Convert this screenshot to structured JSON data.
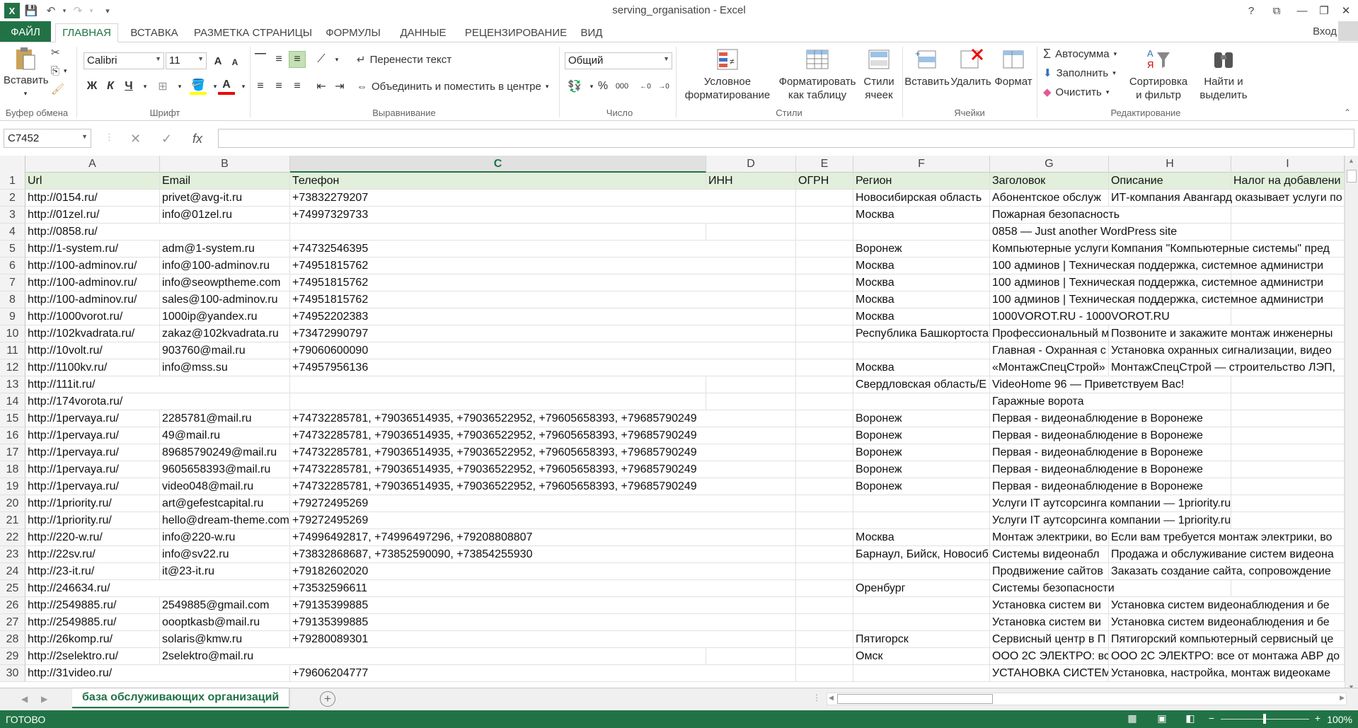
{
  "window": {
    "title": "serving_organisation - Excel",
    "signin": "Вход",
    "help": "?",
    "restore_ribbon": "⧉",
    "minimize": "—",
    "maximize": "❐",
    "close": "✕"
  },
  "tabs": [
    "ФАЙЛ",
    "ГЛАВНАЯ",
    "ВСТАВКА",
    "РАЗМЕТКА СТРАНИЦЫ",
    "ФОРМУЛЫ",
    "ДАННЫЕ",
    "РЕЦЕНЗИРОВАНИЕ",
    "ВИД"
  ],
  "ribbon": {
    "clipboard": {
      "label": "Буфер обмена",
      "paste": "Вставить"
    },
    "font": {
      "label": "Шрифт",
      "name": "Calibri",
      "size": "11",
      "bold": "Ж",
      "italic": "К",
      "underline": "Ч",
      "grow": "A",
      "shrink": "A"
    },
    "alignment": {
      "label": "Выравнивание",
      "wrap": "Перенести текст",
      "merge": "Объединить и поместить в центре"
    },
    "number": {
      "label": "Число",
      "format": "Общий",
      "percent": "%",
      "thousands": "000"
    },
    "styles": {
      "label": "Стили",
      "cond_line1": "Условное",
      "cond_line2": "форматирование",
      "table_line1": "Форматировать",
      "table_line2": "как таблицу",
      "cell_line1": "Стили",
      "cell_line2": "ячеек"
    },
    "cells": {
      "label": "Ячейки",
      "insert": "Вставить",
      "delete": "Удалить",
      "format": "Формат"
    },
    "editing": {
      "label": "Редактирование",
      "autosum": "Автосумма",
      "fill": "Заполнить",
      "clear": "Очистить",
      "sort_line1": "Сортировка",
      "sort_line2": "и фильтр",
      "find_line1": "Найти и",
      "find_line2": "выделить"
    }
  },
  "formula_bar": {
    "name_box": "C7452",
    "fx": "fx",
    "value": ""
  },
  "columns": [
    "A",
    "B",
    "C",
    "D",
    "E",
    "F",
    "G",
    "H",
    "I"
  ],
  "selected_column": "C",
  "rows": [
    {
      "n": "1",
      "c": [
        "Url",
        "Email",
        "Телефон",
        "ИНН",
        "ОГРН",
        "Регион",
        "Заголовок",
        "Описание",
        "Налог на добавлени"
      ]
    },
    {
      "n": "2",
      "c": [
        "http://0154.ru/",
        "privet@avg-it.ru",
        "+73832279207",
        "",
        "",
        "Новосибирская область",
        "Абонентское обслуж",
        "ИТ-компания Авангард оказывает услуги по",
        ""
      ]
    },
    {
      "n": "3",
      "c": [
        "http://01zel.ru/",
        "info@01zel.ru",
        "+74997329733",
        "",
        "",
        "Москва",
        "Пожарная безопасность",
        "",
        ""
      ]
    },
    {
      "n": "4",
      "c": [
        "http://0858.ru/",
        "",
        "",
        "",
        "",
        "",
        "0858 — Just another WordPress site",
        "",
        ""
      ]
    },
    {
      "n": "5",
      "c": [
        "http://1-system.ru/",
        "adm@1-system.ru",
        "+74732546395",
        "",
        "",
        "Воронеж",
        "Компьютерные услуги",
        "Компания \"Компьютерные системы\" пред",
        ""
      ]
    },
    {
      "n": "6",
      "c": [
        "http://100-adminov.ru/",
        "info@100-adminov.ru",
        "+74951815762",
        "",
        "",
        "Москва",
        "100 админов | Техническая поддержка, системное администри",
        "",
        ""
      ]
    },
    {
      "n": "7",
      "c": [
        "http://100-adminov.ru/",
        "info@seowptheme.com",
        "+74951815762",
        "",
        "",
        "Москва",
        "100 админов | Техническая поддержка, системное администри",
        "",
        ""
      ]
    },
    {
      "n": "8",
      "c": [
        "http://100-adminov.ru/",
        "sales@100-adminov.ru",
        "+74951815762",
        "",
        "",
        "Москва",
        "100 админов | Техническая поддержка, системное администри",
        "",
        ""
      ]
    },
    {
      "n": "9",
      "c": [
        "http://1000vorot.ru/",
        "1000ip@yandex.ru",
        "+74952202383",
        "",
        "",
        "Москва",
        "1000VOROT.RU - 1000VOROT.RU",
        "",
        ""
      ]
    },
    {
      "n": "10",
      "c": [
        "http://102kvadrata.ru/",
        "zakaz@102kvadrata.ru",
        "+73472990797",
        "",
        "",
        "Республика Башкортостан",
        "Профессиональный м",
        "Позвоните и закажите монтаж инженерны",
        ""
      ]
    },
    {
      "n": "11",
      "c": [
        "http://10volt.ru/",
        "903760@mail.ru",
        "+79060600090",
        "",
        "",
        "",
        "Главная - Охранная с",
        "Установка охранных сигнализации, видео",
        ""
      ]
    },
    {
      "n": "12",
      "c": [
        "http://1100kv.ru/",
        "info@mss.su",
        "+74957956136",
        "",
        "",
        "Москва",
        "«МонтажСпецСтрой»",
        "МонтажСпецСтрой — строительство ЛЭП,",
        ""
      ]
    },
    {
      "n": "13",
      "c": [
        "http://111it.ru/",
        "",
        "",
        "",
        "",
        "Свердловская область/Е",
        "VideoHome 96 — Приветствуем Вас!",
        "",
        ""
      ]
    },
    {
      "n": "14",
      "c": [
        "http://174vorota.ru/",
        "",
        "",
        "",
        "",
        "",
        "Гаражные ворота",
        "",
        ""
      ]
    },
    {
      "n": "15",
      "c": [
        "http://1pervaya.ru/",
        "2285781@mail.ru",
        "+74732285781, +79036514935, +79036522952, +79605658393, +79685790249",
        "",
        "",
        "Воронеж",
        "Первая - видеонаблюдение в Воронеже",
        "",
        ""
      ]
    },
    {
      "n": "16",
      "c": [
        "http://1pervaya.ru/",
        "49@mail.ru",
        "+74732285781, +79036514935, +79036522952, +79605658393, +79685790249",
        "",
        "",
        "Воронеж",
        "Первая - видеонаблюдение в Воронеже",
        "",
        ""
      ]
    },
    {
      "n": "17",
      "c": [
        "http://1pervaya.ru/",
        "89685790249@mail.ru",
        "+74732285781, +79036514935, +79036522952, +79605658393, +79685790249",
        "",
        "",
        "Воронеж",
        "Первая - видеонаблюдение в Воронеже",
        "",
        ""
      ]
    },
    {
      "n": "18",
      "c": [
        "http://1pervaya.ru/",
        "9605658393@mail.ru",
        "+74732285781, +79036514935, +79036522952, +79605658393, +79685790249",
        "",
        "",
        "Воронеж",
        "Первая - видеонаблюдение в Воронеже",
        "",
        ""
      ]
    },
    {
      "n": "19",
      "c": [
        "http://1pervaya.ru/",
        "video048@mail.ru",
        "+74732285781, +79036514935, +79036522952, +79605658393, +79685790249",
        "",
        "",
        "Воронеж",
        "Первая - видеонаблюдение в Воронеже",
        "",
        ""
      ]
    },
    {
      "n": "20",
      "c": [
        "http://1priority.ru/",
        "art@gefestcapital.ru",
        "+79272495269",
        "",
        "",
        "",
        "Услуги IT аутсорсинга компании — 1priority.ru",
        "",
        ""
      ]
    },
    {
      "n": "21",
      "c": [
        "http://1priority.ru/",
        "hello@dream-theme.com",
        "+79272495269",
        "",
        "",
        "",
        "Услуги IT аутсорсинга компании — 1priority.ru",
        "",
        ""
      ]
    },
    {
      "n": "22",
      "c": [
        "http://220-w.ru/",
        "info@220-w.ru",
        "+74996492817, +74996497296, +79208808807",
        "",
        "",
        "Москва",
        "Монтаж электрики, во",
        "Если вам требуется монтаж электрики, во",
        ""
      ]
    },
    {
      "n": "23",
      "c": [
        "http://22sv.ru/",
        "info@sv22.ru",
        "+73832868687, +73852590090, +73854255930",
        "",
        "",
        "Барнаул, Бийск, Новосиб",
        "Системы видеонабл",
        "Продажа и обслуживание систем видеона",
        ""
      ]
    },
    {
      "n": "24",
      "c": [
        "http://23-it.ru/",
        "it@23-it.ru",
        "+79182602020",
        "",
        "",
        "",
        "Продвижение сайтов",
        "Заказать создание сайта, сопровождение",
        ""
      ]
    },
    {
      "n": "25",
      "c": [
        "http://246634.ru/",
        "",
        "+73532596611",
        "",
        "",
        "Оренбург",
        "Системы безопасности",
        "",
        ""
      ]
    },
    {
      "n": "26",
      "c": [
        "http://2549885.ru/",
        "2549885@gmail.com",
        "+79135399885",
        "",
        "",
        "",
        "Установка систем ви",
        "Установка систем видеонаблюдения и бе",
        ""
      ]
    },
    {
      "n": "27",
      "c": [
        "http://2549885.ru/",
        "oooptkasb@mail.ru",
        "+79135399885",
        "",
        "",
        "",
        "Установка систем ви",
        "Установка систем видеонаблюдения и бе",
        ""
      ]
    },
    {
      "n": "28",
      "c": [
        "http://26komp.ru/",
        "solaris@kmw.ru",
        "+79280089301",
        "",
        "",
        "Пятигорск",
        "Сервисный центр в П",
        "Пятигорский компьютерный сервисный це",
        ""
      ]
    },
    {
      "n": "29",
      "c": [
        "http://2selektro.ru/",
        "2selektro@mail.ru",
        "",
        "",
        "",
        "Омск",
        "ООО 2С ЭЛЕКТРО: все",
        "ООО 2С ЭЛЕКТРО: все от монтажа АВР до",
        ""
      ]
    },
    {
      "n": "30",
      "c": [
        "http://31video.ru/",
        "",
        "+79606204777",
        "",
        "",
        "",
        "УСТАНОВКА СИСТЕМ",
        "Установка, настройка, монтаж видеокаме",
        ""
      ]
    }
  ],
  "sheet_tab": "база обслуживающих организаций",
  "add_sheet": "+",
  "status": {
    "ready": "ГОТОВО",
    "zoom": "100%",
    "zoom_out": "−",
    "zoom_in": "+"
  },
  "colors": {
    "accent": "#217346",
    "header_row": "#e2efda"
  }
}
